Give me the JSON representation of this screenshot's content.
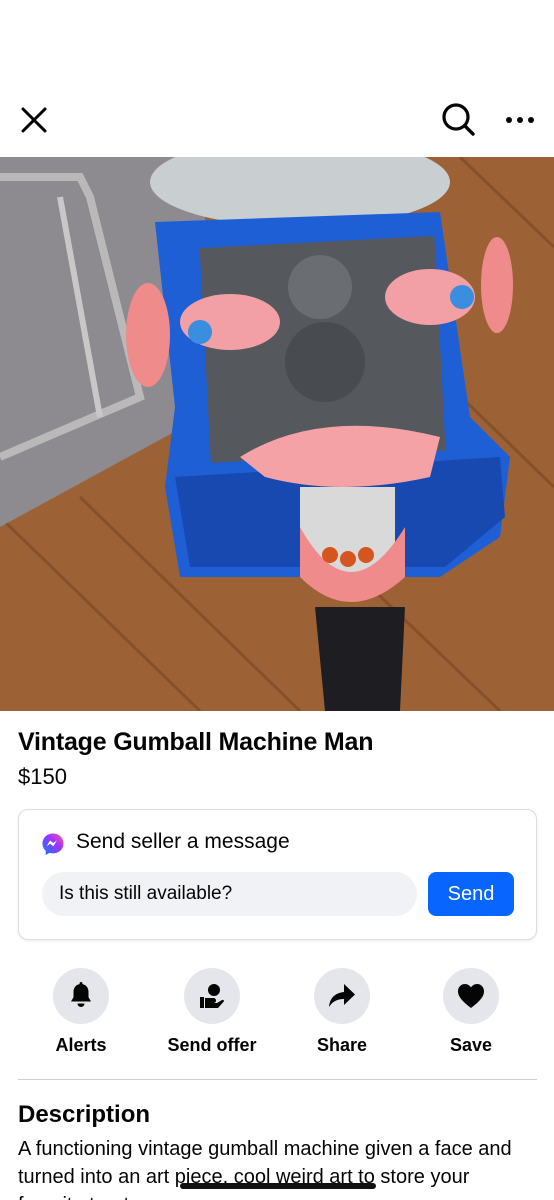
{
  "topbar": {
    "close_icon": "close-icon",
    "search_icon": "search-icon",
    "more_icon": "more-horizontal-icon"
  },
  "photo": {
    "description_icon": "listing-photo",
    "pager": {
      "count": 5,
      "active_index": 0
    }
  },
  "listing": {
    "title": "Vintage Gumball Machine Man",
    "price": "$150"
  },
  "message": {
    "icon": "messenger-icon",
    "heading": "Send seller a message",
    "input_value": "Is this still available?",
    "send_label": "Send"
  },
  "actions": [
    {
      "label": "Alerts",
      "icon": "bell-icon"
    },
    {
      "label": "Send offer",
      "icon": "offer-icon"
    },
    {
      "label": "Share",
      "icon": "share-icon"
    },
    {
      "label": "Save",
      "icon": "heart-icon"
    }
  ],
  "description": {
    "heading": "Description",
    "text": "A functioning vintage gumball machine given a face and turned into an art piece, cool weird art to store your favorite treats"
  },
  "colors": {
    "accent": "#0866ff",
    "button_bg": "#e4e6eb",
    "input_bg": "#f0f2f5"
  }
}
